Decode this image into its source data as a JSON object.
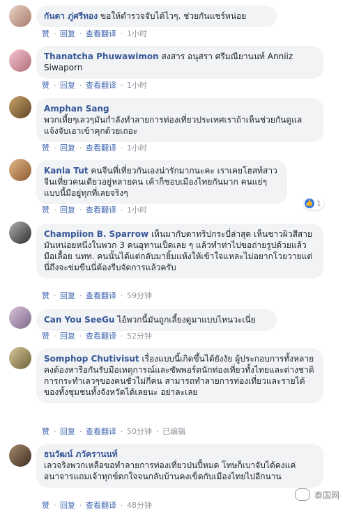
{
  "comments": [
    {
      "name": "กันตา ภู่ศรีทอง",
      "text": "ขอให้ตำรวจจับได้ไวๆ. ช่วยกันแชร์หน่อย",
      "actions": {
        "like": "赞",
        "reply": "回复",
        "translate": "查看翻译",
        "time": "1小时"
      }
    },
    {
      "name": "Thanatcha Phuwawimon",
      "text": "สงสาร อนุสรา ศรีมณียานนท์ Anniiz Siwaporn",
      "actions": {
        "like": "赞",
        "reply": "回复",
        "translate": "查看翻译",
        "time": "1小时"
      }
    },
    {
      "name": "Amphan Sang",
      "text": "พวกเหี้ยๆเลวๆมันกำลังทำลายการท่องเที่ยวประเทศเราถ้าเห็นช่วยกันดูแล แจ้งจับเอาเข้าคุกด้วยเถอะ",
      "actions": {
        "like": "赞",
        "reply": "回复",
        "translate": "查看翻译",
        "time": "1小时"
      }
    },
    {
      "name": "Kanla Tut",
      "text": "คนจีนที่เที่ยวกันเองน่ารักมากนะคะ เราเคยโฮสท์สาวจีนเที่ยวคนเดียวอยู่หลายคน เค้าก็ชอบเมืองไทยกันมาก คนแย่ๆแบบนี้มีอยู่ทุกที่เลยจริงๆ",
      "actions": {
        "like": "赞",
        "reply": "回复",
        "translate": "查看翻译",
        "time": "1小时"
      },
      "likes": "1"
    },
    {
      "name": "Champiion B. Sparrow",
      "text": "เห็นมากับตาทริปกระบี่ล่าสุด เห็นชาวผิวสีสายมันหน่อยหนึ่งในพวก 3 คนอุทานเป็ดเลย ๆ แล้วทำท่าไปขอถ่ายรูปด้วยแล้วมือเลื้อย นทท. คนนั้นได้แต่กลับมายิ้มแห้งให้เข้าใจแหละไม่อยากโวยวายแต่นี่ถึงจะข่มขืนนี่ต้องรีบจัดการแล้วครับ",
      "actions": {
        "like": "赞",
        "reply": "回复",
        "translate": "查看翻译",
        "time": "59分钟"
      }
    },
    {
      "name": "Can You SeeGu",
      "text": "ไอ้พวกนี้มันถูกเลี้ยงดูมาแบบไหนวะเนี่ย",
      "actions": {
        "like": "赞",
        "reply": "回复",
        "translate": "查看翻译",
        "time": "52分钟"
      }
    },
    {
      "name": "Somphop Chutivisut",
      "text": "เรื่องแบบนี้เกิดขึ้นได้ยังงัย ผู้ประกอบการทั้งหลาย คงต้องหารือกันรับมือเหตุการณ์และซัพพอร์ตนักท่องเที่ยวทั้งไทยและต่างชาติ การกระทำเลวๆของคนชั่วไม่กี่คน สามารถทำลายการท่องเที่ยวและรายได้ของทั้งชุมชนทั้งจังหวัดได้เลยนะ อย่าละเลย",
      "actions": {
        "like": "赞",
        "reply": "回复",
        "translate": "查看翻译",
        "time": "50分钟",
        "edited": "已编辑"
      }
    },
    {
      "name": "ธนวัฒน์ ภวัครานนท์",
      "text": "เลวจริงพวกเหลือขอทำลายการท่องเที่ยวป่นปี้หมด โทษก็เบาจับได้คงแค่อนาจารแถมเจ้าทุกข์ตกใจจนกลับบ้านคงเข็ดกับเมืองไทยไปอีกนาน",
      "actions": {
        "like": "赞",
        "reply": "回复",
        "translate": "查看翻译",
        "time": "48分钟"
      }
    }
  ],
  "watermark": "泰国网",
  "colors": {
    "name": "#385898",
    "bubble": "#f2f3f5",
    "meta": "#90949c"
  }
}
